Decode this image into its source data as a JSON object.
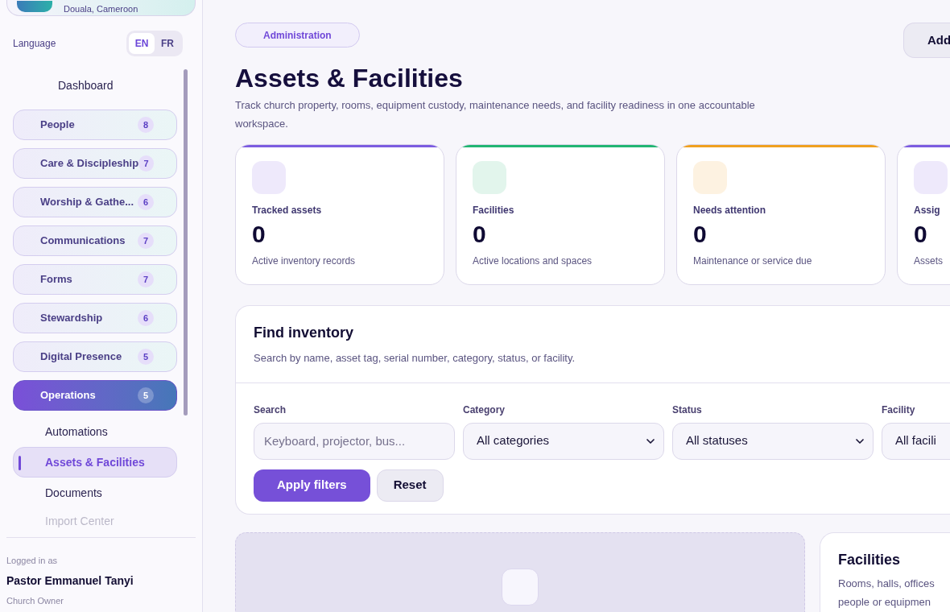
{
  "sidebar": {
    "org_card": {
      "subtitle": "Douala, Cameroon"
    },
    "language": {
      "label": "Language",
      "options": [
        {
          "label": "EN",
          "selected": true
        },
        {
          "label": "FR",
          "selected": false
        }
      ]
    },
    "nav": [
      {
        "label": "Dashboard",
        "kind": "link"
      },
      {
        "label": "People",
        "kind": "group",
        "badge": "8",
        "expanded": false
      },
      {
        "label": "Care & Discipleship",
        "kind": "group",
        "badge": "7",
        "expanded": false
      },
      {
        "label": "Worship & Gathe...",
        "kind": "group",
        "badge": "6",
        "expanded": false
      },
      {
        "label": "Communications",
        "kind": "group",
        "badge": "7",
        "expanded": false
      },
      {
        "label": "Forms",
        "kind": "group",
        "badge": "7",
        "expanded": false
      },
      {
        "label": "Stewardship",
        "kind": "group",
        "badge": "6",
        "expanded": false
      },
      {
        "label": "Digital Presence",
        "kind": "group",
        "badge": "5",
        "expanded": false
      },
      {
        "label": "Operations",
        "kind": "group",
        "badge": "5",
        "expanded": true,
        "children": [
          {
            "label": "Automations",
            "selected": false
          },
          {
            "label": "Assets & Facilities",
            "selected": true
          },
          {
            "label": "Documents",
            "selected": false
          },
          {
            "label": "Import Center",
            "selected": false
          }
        ]
      }
    ],
    "user": {
      "caption": "Logged in as",
      "name": "Pastor Emmanuel Tanyi",
      "role": "Church Owner"
    }
  },
  "header": {
    "eyebrow": "Administration",
    "title": "Assets & Facilities",
    "description": "Track church property, rooms, equipment custody, maintenance needs, and facility readiness in one accountable workspace.",
    "action": "Add"
  },
  "stats": [
    {
      "label": "Tracked assets",
      "value": "0",
      "caption": "Active inventory records",
      "color": "#7c5ce0"
    },
    {
      "label": "Facilities",
      "value": "0",
      "caption": "Active locations and spaces",
      "color": "#22b573"
    },
    {
      "label": "Needs attention",
      "value": "0",
      "caption": "Maintenance or service due",
      "color": "#f0a020"
    },
    {
      "label": "Assig",
      "value": "0",
      "caption": "Assets",
      "color": "#7c5ce0"
    }
  ],
  "filters": {
    "title": "Find inventory",
    "description": "Search by name, asset tag, serial number, category, status, or facility.",
    "fields": [
      {
        "label": "Search",
        "kind": "input",
        "placeholder": "Keyboard, projector, bus..."
      },
      {
        "label": "Category",
        "kind": "select",
        "value": "All categories"
      },
      {
        "label": "Status",
        "kind": "select",
        "value": "All statuses"
      },
      {
        "label": "Facility",
        "kind": "select",
        "value": "All facili"
      }
    ],
    "buttons": [
      {
        "label": "Apply filters",
        "kind": "primary"
      },
      {
        "label": "Reset",
        "kind": "secondary"
      }
    ]
  },
  "facilities_card": {
    "title": "Facilities",
    "description": "Rooms, halls, offices",
    "description_2": "people or equipmen"
  }
}
